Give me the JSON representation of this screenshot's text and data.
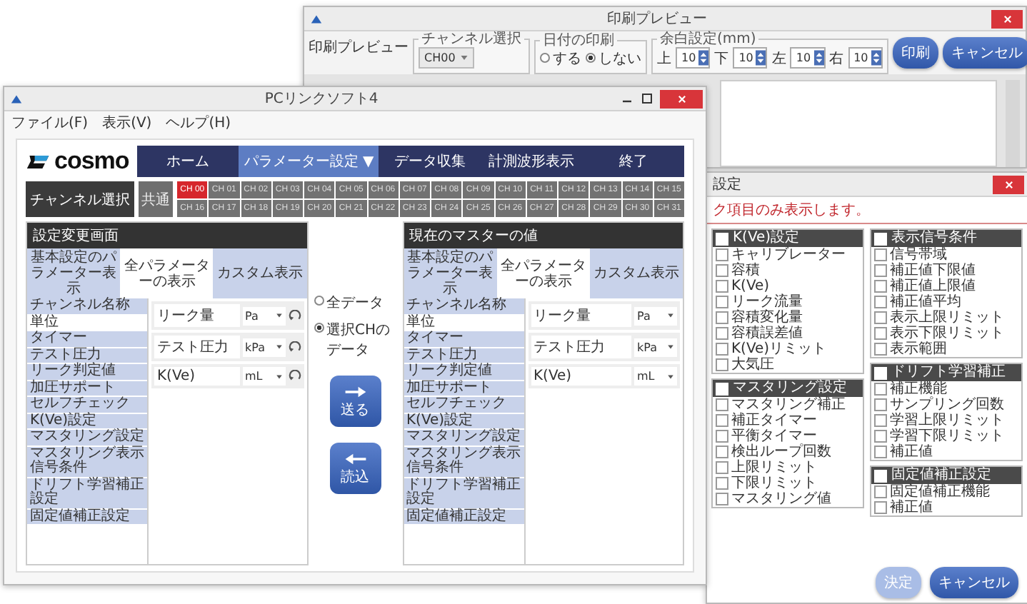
{
  "print_window": {
    "title": "印刷プレビュー",
    "label": "印刷プレビュー",
    "channel_group": {
      "legend": "チャンネル選択",
      "value": "CH00"
    },
    "date_group": {
      "legend": "日付の印刷",
      "options": [
        {
          "label": "する",
          "selected": false
        },
        {
          "label": "しない",
          "selected": true
        }
      ]
    },
    "margin_group": {
      "legend": "余白設定(mm)",
      "fields": [
        {
          "label": "上",
          "value": "10"
        },
        {
          "label": "下",
          "value": "10"
        },
        {
          "label": "左",
          "value": "10"
        },
        {
          "label": "右",
          "value": "10"
        }
      ]
    },
    "buttons": [
      {
        "label": "印刷"
      },
      {
        "label": "キャンセル"
      }
    ]
  },
  "settings_window": {
    "title": "設定",
    "message": "ク項目のみ表示します。",
    "columns": [
      {
        "groups": [
          {
            "title": "K(Ve)設定",
            "checked": false,
            "items": [
              {
                "label": "キャリブレーター",
                "checked": false
              },
              {
                "label": "容積",
                "checked": false
              },
              {
                "label": "K(Ve)",
                "checked": false
              },
              {
                "label": "リーク流量",
                "checked": false
              },
              {
                "label": "容積変化量",
                "checked": false
              },
              {
                "label": "容積誤差値",
                "checked": false
              },
              {
                "label": "K(Ve)リミット",
                "checked": false
              },
              {
                "label": "大気圧",
                "checked": false
              }
            ]
          },
          {
            "title": "マスタリング設定",
            "checked": false,
            "items": [
              {
                "label": "マスタリング補正",
                "checked": false
              },
              {
                "label": "補正タイマー",
                "checked": false
              },
              {
                "label": "平衡タイマー",
                "checked": false
              },
              {
                "label": "検出ループ回数",
                "checked": false
              },
              {
                "label": "上限リミット",
                "checked": false
              },
              {
                "label": "下限リミット",
                "checked": false
              },
              {
                "label": "マスタリング値",
                "checked": false
              }
            ]
          }
        ]
      },
      {
        "groups": [
          {
            "title": "表示信号条件",
            "checked": false,
            "items": [
              {
                "label": "信号帯域",
                "checked": false
              },
              {
                "label": "補正値下限値",
                "checked": false
              },
              {
                "label": "補正値上限値",
                "checked": false
              },
              {
                "label": "補正値平均",
                "checked": false
              },
              {
                "label": "表示上限リミット",
                "checked": false
              },
              {
                "label": "表示下限リミット",
                "checked": false
              },
              {
                "label": "表示範囲",
                "checked": false
              }
            ]
          },
          {
            "title": "ドリフト学習補正",
            "checked": false,
            "items": [
              {
                "label": "補正機能",
                "checked": false
              },
              {
                "label": "サンプリング回数",
                "checked": false
              },
              {
                "label": "学習上限リミット",
                "checked": false
              },
              {
                "label": "学習下限リミット",
                "checked": false
              },
              {
                "label": "補正値",
                "checked": false
              }
            ]
          },
          {
            "title": "固定値補正設定",
            "checked": false,
            "items": [
              {
                "label": "固定値補正機能",
                "checked": false
              },
              {
                "label": "補正値",
                "checked": false
              }
            ]
          }
        ]
      }
    ],
    "buttons": [
      {
        "label": "決定",
        "disabled": true
      },
      {
        "label": "キャンセル",
        "disabled": false
      }
    ]
  },
  "main_window": {
    "title": "PCリンクソフト4",
    "menu": [
      "ファイル(F)",
      "表示(V)",
      "ヘルプ(H)"
    ],
    "logo": "cosmo",
    "nav": [
      {
        "label": "ホーム",
        "selected": false
      },
      {
        "label": "パラメーター設定 ▼",
        "selected": true
      },
      {
        "label": "データ収集",
        "selected": false
      },
      {
        "label": "計測波形表示",
        "selected": false
      },
      {
        "label": "終了",
        "selected": false
      }
    ],
    "channel_select_label": "チャンネル選択",
    "common_button": "共通",
    "channels": [
      {
        "label": "CH 00",
        "selected": true
      },
      {
        "label": "CH 01",
        "selected": false
      },
      {
        "label": "CH 02",
        "selected": false
      },
      {
        "label": "CH 03",
        "selected": false
      },
      {
        "label": "CH 04",
        "selected": false
      },
      {
        "label": "CH 05",
        "selected": false
      },
      {
        "label": "CH 06",
        "selected": false
      },
      {
        "label": "CH 07",
        "selected": false
      },
      {
        "label": "CH 08",
        "selected": false
      },
      {
        "label": "CH 09",
        "selected": false
      },
      {
        "label": "CH 10",
        "selected": false
      },
      {
        "label": "CH 11",
        "selected": false
      },
      {
        "label": "CH 12",
        "selected": false
      },
      {
        "label": "CH 13",
        "selected": false
      },
      {
        "label": "CH 14",
        "selected": false
      },
      {
        "label": "CH 15",
        "selected": false
      },
      {
        "label": "CH 16",
        "selected": false
      },
      {
        "label": "CH 17",
        "selected": false
      },
      {
        "label": "CH 18",
        "selected": false
      },
      {
        "label": "CH 19",
        "selected": false
      },
      {
        "label": "CH 20",
        "selected": false
      },
      {
        "label": "CH 21",
        "selected": false
      },
      {
        "label": "CH 22",
        "selected": false
      },
      {
        "label": "CH 23",
        "selected": false
      },
      {
        "label": "CH 24",
        "selected": false
      },
      {
        "label": "CH 25",
        "selected": false
      },
      {
        "label": "CH 26",
        "selected": false
      },
      {
        "label": "CH 27",
        "selected": false
      },
      {
        "label": "CH 28",
        "selected": false
      },
      {
        "label": "CH 29",
        "selected": false
      },
      {
        "label": "CH 30",
        "selected": false
      },
      {
        "label": "CH 31",
        "selected": false
      }
    ],
    "panels": [
      {
        "kind": "editable",
        "header": "設定変更画面",
        "tabs": [
          {
            "label": "基本設定のパラメーター表示",
            "selected": false
          },
          {
            "label": "全パラメーターの表示",
            "selected": true
          },
          {
            "label": "カスタム表示",
            "selected": false
          }
        ],
        "items": [
          {
            "label": "チャンネル名称",
            "selected": false
          },
          {
            "label": "単位",
            "selected": true
          },
          {
            "label": "タイマー",
            "selected": false
          },
          {
            "label": "テスト圧力",
            "selected": false
          },
          {
            "label": "リーク判定値",
            "selected": false
          },
          {
            "label": "加圧サポート",
            "selected": false
          },
          {
            "label": "セルフチェック",
            "selected": false
          },
          {
            "label": "K(Ve)設定",
            "selected": false
          },
          {
            "label": "マスタリング設定",
            "selected": false
          },
          {
            "label": "マスタリング表示信号条件",
            "selected": false
          },
          {
            "label": "ドリフト学習補正設定",
            "selected": false
          },
          {
            "label": "固定値補正設定",
            "selected": false
          }
        ],
        "rows": [
          {
            "name": "リーク量",
            "unit": "Pa"
          },
          {
            "name": "テスト圧力",
            "unit": "kPa"
          },
          {
            "name": "K(Ve)",
            "unit": "mL"
          }
        ]
      },
      {
        "kind": "current",
        "header": "現在のマスターの値",
        "tabs": [
          {
            "label": "基本設定のパラメーター表示",
            "selected": false
          },
          {
            "label": "全パラメーターの表示",
            "selected": true
          },
          {
            "label": "カスタム表示",
            "selected": false
          }
        ],
        "items": [
          {
            "label": "チャンネル名称",
            "selected": false
          },
          {
            "label": "単位",
            "selected": true
          },
          {
            "label": "タイマー",
            "selected": false
          },
          {
            "label": "テスト圧力",
            "selected": false
          },
          {
            "label": "リーク判定値",
            "selected": false
          },
          {
            "label": "加圧サポート",
            "selected": false
          },
          {
            "label": "セルフチェック",
            "selected": false
          },
          {
            "label": "K(Ve)設定",
            "selected": false
          },
          {
            "label": "マスタリング設定",
            "selected": false
          },
          {
            "label": "マスタリング表示信号条件",
            "selected": false
          },
          {
            "label": "ドリフト学習補正設定",
            "selected": false
          },
          {
            "label": "固定値補正設定",
            "selected": false
          }
        ],
        "rows": [
          {
            "name": "リーク量",
            "unit": "Pa"
          },
          {
            "name": "テスト圧力",
            "unit": "kPa"
          },
          {
            "name": "K(Ve)",
            "unit": "mL"
          }
        ]
      }
    ],
    "transfer": {
      "options": [
        {
          "label": "全データ",
          "selected": false
        },
        {
          "label": "選択CHのデータ",
          "selected": true
        }
      ],
      "buttons": [
        {
          "kind": "send",
          "label": "送る"
        },
        {
          "kind": "receive",
          "label": "読込"
        }
      ]
    }
  }
}
